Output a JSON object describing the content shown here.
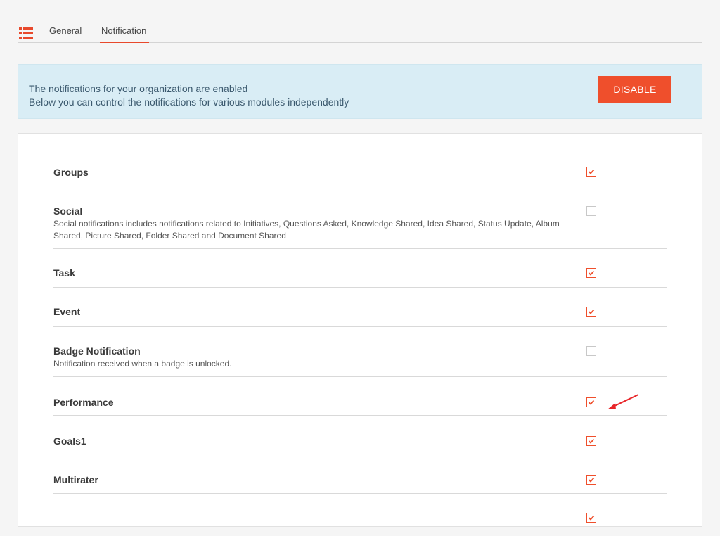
{
  "tabs": {
    "menu_icon": "list-icon",
    "items": [
      {
        "label": "General"
      },
      {
        "label": "Notification",
        "active": true
      }
    ]
  },
  "banner": {
    "line1": "The notifications for your organization are enabled",
    "line2": "Below you can control the notifications for various modules independently",
    "button_label": "DISABLE"
  },
  "notifications": [
    {
      "title": "Groups",
      "description": "",
      "checked": true
    },
    {
      "title": "Social",
      "description": "Social notifications includes notifications related to Initiatives, Questions Asked, Knowledge Shared, Idea Shared, Status Update, Album Shared, Picture Shared, Folder Shared and Document Shared",
      "checked": false
    },
    {
      "title": "Task",
      "description": "",
      "checked": true
    },
    {
      "title": "Event",
      "description": "",
      "checked": true
    },
    {
      "title": "Badge Notification",
      "description": "Notification received when a badge is unlocked.",
      "checked": false
    },
    {
      "title": "Performance",
      "description": "",
      "checked": true
    },
    {
      "title": "Goals1",
      "description": "",
      "checked": true
    },
    {
      "title": "Multirater",
      "description": "",
      "checked": true
    }
  ],
  "colors": {
    "accent": "#ef4f2c",
    "banner_bg": "#d9edf5",
    "banner_text": "#3c5a6f"
  }
}
